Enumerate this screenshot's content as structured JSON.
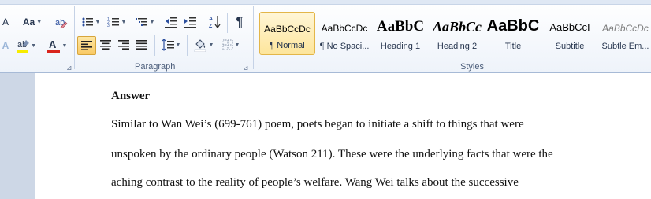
{
  "font_group": {
    "font_size_arrow": "A",
    "case_button": "Aa",
    "text_color": "#d9241c",
    "highlight_color": "#f7ec00"
  },
  "paragraph_group": {
    "label": "Paragraph",
    "pilcrow": "¶"
  },
  "styles_group": {
    "label": "Styles",
    "items": [
      {
        "sample": "AaBbCcDc",
        "name": "¶ Normal",
        "selected": true
      },
      {
        "sample": "AaBbCcDc",
        "name": "¶ No Spaci..."
      },
      {
        "sample": "AaBbC",
        "name": "Heading 1"
      },
      {
        "sample": "AaBbCc",
        "name": "Heading 2"
      },
      {
        "sample": "AaBbC",
        "name": "Title"
      },
      {
        "sample": "AaBbCcI",
        "name": "Subtitle"
      },
      {
        "sample": "AaBbCcDc",
        "name": "Subtle Em..."
      }
    ]
  },
  "document": {
    "heading": "Answer",
    "lines": [
      "Similar to Wan Wei’s (699-761) poem, poets began to initiate a shift to things that were",
      "unspoken by the ordinary people (Watson 211). These  were the underlying facts that were the",
      "aching contrast to the reality of people’s welfare. Wang Wei talks about the successive"
    ]
  }
}
